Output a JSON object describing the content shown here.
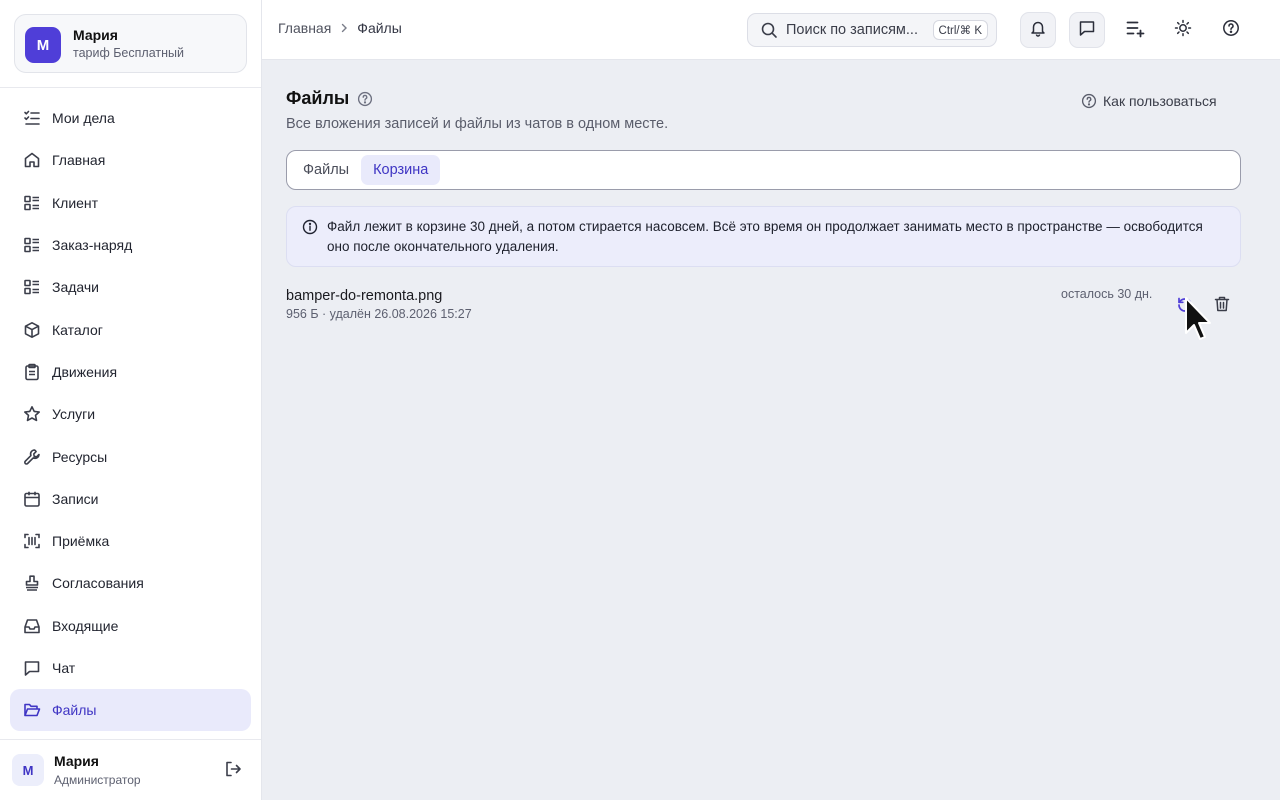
{
  "account": {
    "avatar_letter": "М",
    "name": "Мария",
    "plan": "тариф Бесплатный",
    "avatar_color": "#4f3ed8"
  },
  "sidebar": {
    "items": [
      {
        "label": "Мои дела",
        "icon": "checklist-icon"
      },
      {
        "label": "Главная",
        "icon": "home-icon"
      },
      {
        "label": "Клиент",
        "icon": "list-icon"
      },
      {
        "label": "Заказ-наряд",
        "icon": "list-icon"
      },
      {
        "label": "Задачи",
        "icon": "list-icon"
      },
      {
        "label": "Каталог",
        "icon": "box-icon"
      },
      {
        "label": "Движения",
        "icon": "clipboard-icon"
      },
      {
        "label": "Услуги",
        "icon": "star-icon"
      },
      {
        "label": "Ресурсы",
        "icon": "wrench-icon"
      },
      {
        "label": "Записи",
        "icon": "calendar-icon"
      },
      {
        "label": "Приёмка",
        "icon": "barcode-scan-icon"
      },
      {
        "label": "Согласования",
        "icon": "stamp-icon"
      },
      {
        "label": "Входящие",
        "icon": "inbox-icon"
      },
      {
        "label": "Чат",
        "icon": "chat-icon"
      },
      {
        "label": "Файлы",
        "icon": "folder-open-icon",
        "active": true
      }
    ]
  },
  "user": {
    "avatar_letter": "М",
    "name": "Мария",
    "role": "Администратор"
  },
  "header": {
    "breadcrumb": [
      "Главная",
      "Файлы"
    ],
    "search_placeholder": "Поиск по записям...",
    "search_shortcut": "Ctrl/⌘ K"
  },
  "page": {
    "title": "Файлы",
    "subtitle": "Все вложения записей и файлы из чатов в одном месте.",
    "howto_label": "Как пользоваться",
    "tabs": [
      {
        "label": "Файлы",
        "active": false
      },
      {
        "label": "Корзина",
        "active": true
      }
    ],
    "notice": "Файл лежит в корзине 30 дней, а потом стирается насовсем. Всё это время он продолжает занимать место в пространстве — освободится оно после окончательного удаления."
  },
  "trash_files": [
    {
      "name": "bamper-do-remonta.png",
      "meta": "956 Б · удалён 26.08.2026 15:27",
      "remaining": "осталось 30 дн."
    }
  ],
  "colors": {
    "accent": "#4f3ed8",
    "active_bg": "#e9eafb",
    "notice_bg": "#ecedfb"
  }
}
